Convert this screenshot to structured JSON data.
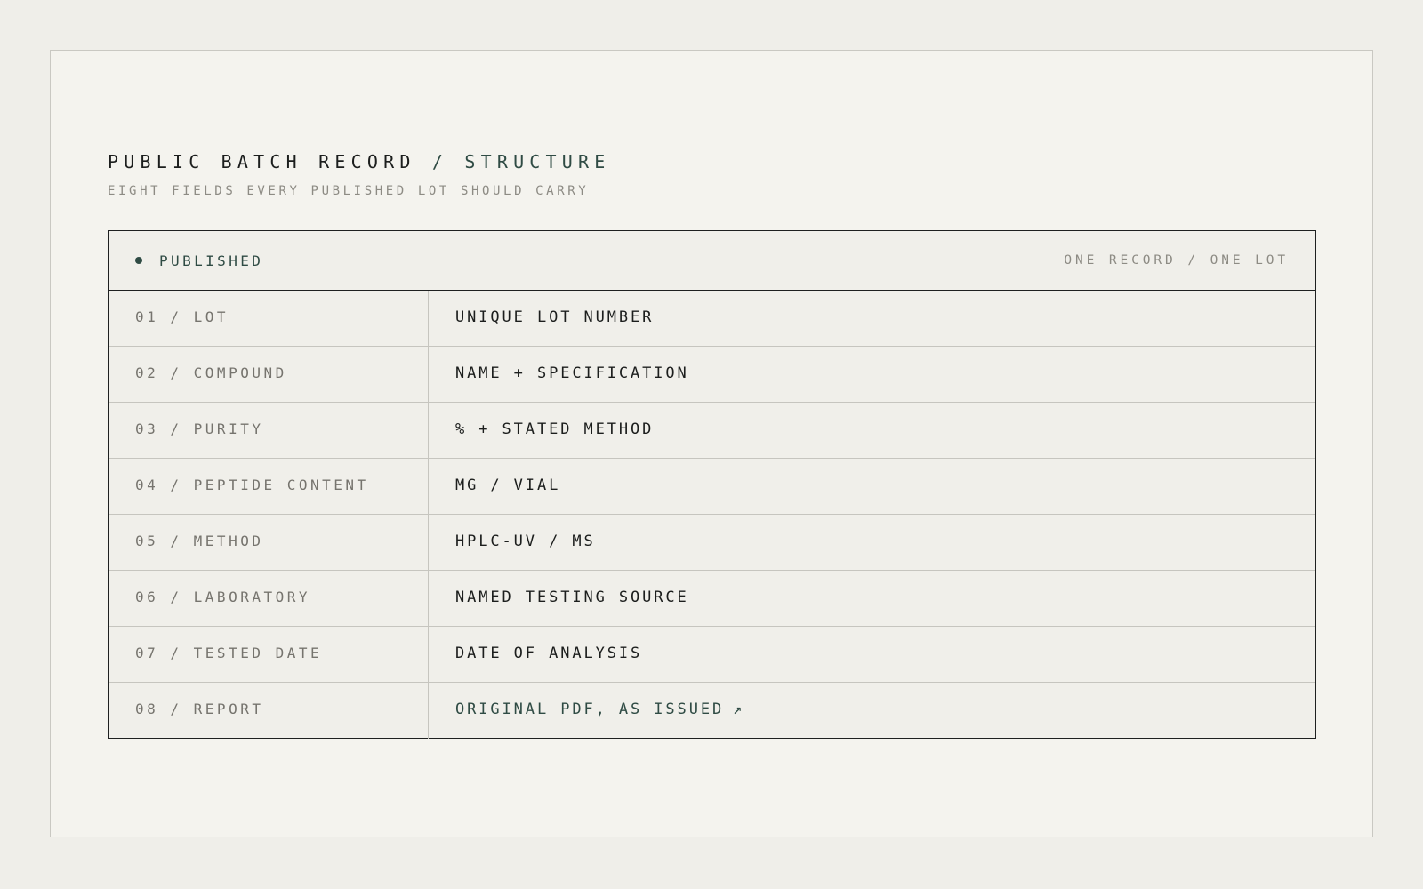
{
  "header": {
    "title": "PUBLIC BATCH RECORD",
    "separator": "/",
    "title_accent": "STRUCTURE",
    "subtitle": "EIGHT FIELDS EVERY PUBLISHED LOT SHOULD CARRY"
  },
  "record": {
    "status": "PUBLISHED",
    "meta": "ONE RECORD / ONE LOT",
    "rows": [
      {
        "label": "01 / LOT",
        "value": "UNIQUE LOT NUMBER"
      },
      {
        "label": "02 / COMPOUND",
        "value": "NAME + SPECIFICATION"
      },
      {
        "label": "03 / PURITY",
        "value": "% + STATED METHOD"
      },
      {
        "label": "04 / PEPTIDE CONTENT",
        "value": "MG / VIAL"
      },
      {
        "label": "05 / METHOD",
        "value": "HPLC-UV / MS"
      },
      {
        "label": "06 / LABORATORY",
        "value": "NAMED TESTING SOURCE"
      },
      {
        "label": "07 / TESTED DATE",
        "value": "DATE OF ANALYSIS"
      },
      {
        "label": "08 / REPORT",
        "value": "ORIGINAL PDF, AS ISSUED",
        "link_arrow": "↗"
      }
    ]
  },
  "colors": {
    "accent": "#2f4b44",
    "background": "#efeee9",
    "text": "#1c1e1d",
    "muted": "#8d8b84"
  },
  "icons": {
    "status": "status-dot-icon",
    "report_link": "arrow-up-right-icon"
  }
}
